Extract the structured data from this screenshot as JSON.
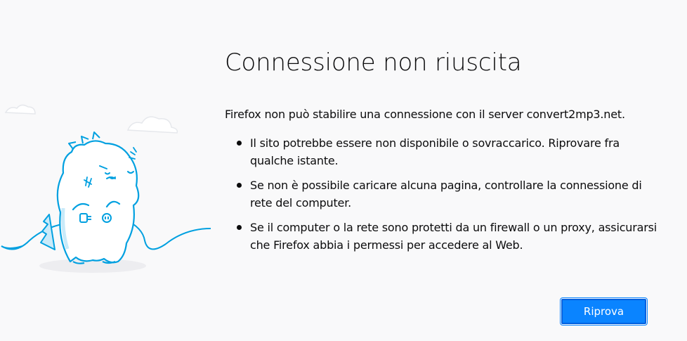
{
  "error": {
    "title": "Connessione non riuscita",
    "description": "Firefox non può stabilire una connessione con il server convert2mp3.net.",
    "bullets": [
      "Il sito potrebbe essere non disponibile o sovraccarico. Riprovare fra qualche istante.",
      "Se non è possibile caricare alcuna pagina, controllare la connessione di rete del computer.",
      "Se il computer o la rete sono protetti da un firewall o un proxy, assicurarsi che Firefox abbia i permessi per accedere al Web."
    ],
    "retry_label": "Riprova"
  },
  "colors": {
    "background": "#f9f9fa",
    "accent": "#0a84ff",
    "illustration_line": "#00a0e0"
  },
  "icons": {
    "illustration": "unplugged-dinosaur-illustration"
  }
}
